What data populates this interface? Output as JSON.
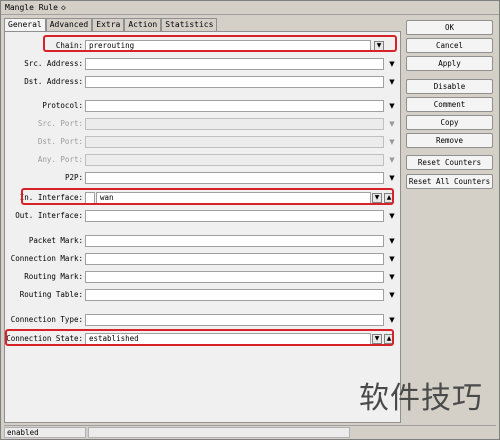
{
  "window": {
    "title": "Mangle Rule"
  },
  "tabs": [
    "General",
    "Advanced",
    "Extra",
    "Action",
    "Statistics"
  ],
  "fields": {
    "chain": {
      "label": "Chain:",
      "value": "prerouting"
    },
    "src_address": {
      "label": "Src. Address:",
      "value": ""
    },
    "dst_address": {
      "label": "Dst. Address:",
      "value": ""
    },
    "protocol": {
      "label": "Protocol:",
      "value": ""
    },
    "src_port": {
      "label": "Src. Port:",
      "value": ""
    },
    "dst_port": {
      "label": "Dst. Port:",
      "value": ""
    },
    "any_port": {
      "label": "Any. Port:",
      "value": ""
    },
    "p2p": {
      "label": "P2P:",
      "value": ""
    },
    "in_interface": {
      "label": "In. Interface:",
      "value": "wan"
    },
    "out_interface": {
      "label": "Out. Interface:",
      "value": ""
    },
    "packet_mark": {
      "label": "Packet Mark:",
      "value": ""
    },
    "connection_mark": {
      "label": "Connection Mark:",
      "value": ""
    },
    "routing_mark": {
      "label": "Routing Mark:",
      "value": ""
    },
    "routing_table": {
      "label": "Routing Table:",
      "value": ""
    },
    "connection_type": {
      "label": "Connection Type:",
      "value": ""
    },
    "connection_state": {
      "label": "Connection State:",
      "value": "established"
    }
  },
  "buttons": {
    "ok": "OK",
    "cancel": "Cancel",
    "apply": "Apply",
    "disable": "Disable",
    "comment": "Comment",
    "copy": "Copy",
    "remove": "Remove",
    "reset_counters": "Reset Counters",
    "reset_all_counters": "Reset All Counters"
  },
  "status": {
    "state": "enabled"
  },
  "watermark": "软件技巧",
  "colors": {
    "highlight": "#d6232a"
  }
}
